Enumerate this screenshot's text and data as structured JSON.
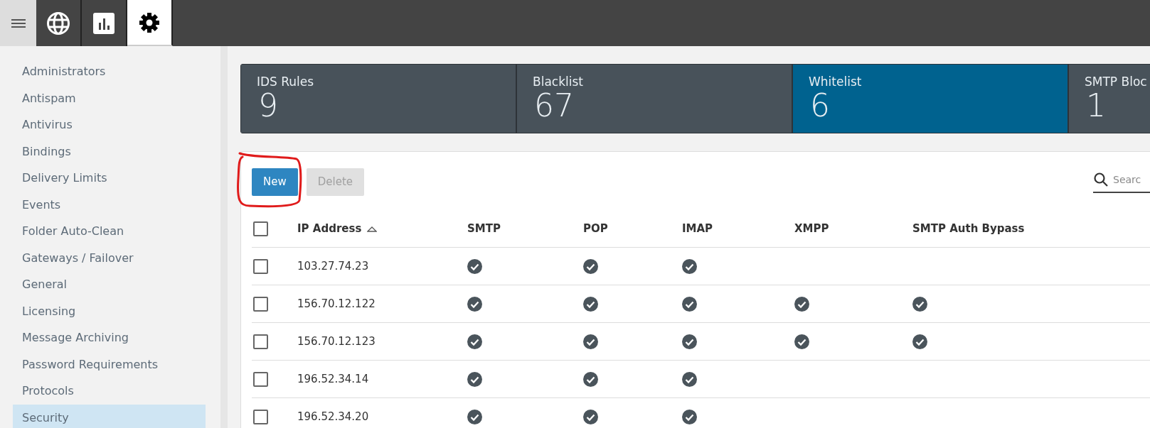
{
  "top_tabs": [
    {
      "kind": "menu",
      "selected": false
    },
    {
      "kind": "globe",
      "selected": false
    },
    {
      "kind": "chart",
      "selected": false
    },
    {
      "kind": "gear",
      "selected": true
    }
  ],
  "sidebar": {
    "items": [
      {
        "label": "Administrators",
        "selected": false
      },
      {
        "label": "Antispam",
        "selected": false
      },
      {
        "label": "Antivirus",
        "selected": false
      },
      {
        "label": "Bindings",
        "selected": false
      },
      {
        "label": "Delivery Limits",
        "selected": false
      },
      {
        "label": "Events",
        "selected": false
      },
      {
        "label": "Folder Auto-Clean",
        "selected": false
      },
      {
        "label": "Gateways / Failover",
        "selected": false
      },
      {
        "label": "General",
        "selected": false
      },
      {
        "label": "Licensing",
        "selected": false
      },
      {
        "label": "Message Archiving",
        "selected": false
      },
      {
        "label": "Password Requirements",
        "selected": false
      },
      {
        "label": "Protocols",
        "selected": false
      },
      {
        "label": "Security",
        "selected": true
      }
    ]
  },
  "summary_cards": [
    {
      "title": "IDS Rules",
      "count": "9",
      "selected": false
    },
    {
      "title": "Blacklist",
      "count": "67",
      "selected": false
    },
    {
      "title": "Whitelist",
      "count": "6",
      "selected": true
    },
    {
      "title": "SMTP Bloc",
      "count": "1",
      "selected": false
    }
  ],
  "toolbar": {
    "buttons": [
      {
        "label": "New",
        "disabled": false
      },
      {
        "label": "Delete",
        "disabled": true
      }
    ],
    "search": {
      "placeholder": "Searc"
    }
  },
  "table": {
    "select_all": {
      "checked": false
    },
    "columns": [
      {
        "label": "IP Address",
        "sorted": true
      },
      {
        "label": "SMTP",
        "sorted": false
      },
      {
        "label": "POP",
        "sorted": false
      },
      {
        "label": "IMAP",
        "sorted": false
      },
      {
        "label": "XMPP",
        "sorted": false
      },
      {
        "label": "SMTP Auth Bypass",
        "sorted": false
      }
    ],
    "rows": [
      {
        "checked": false,
        "ip": "103.27.74.23",
        "smtp": true,
        "pop": true,
        "imap": true,
        "xmpp": false,
        "smtp_auth_bypass": false
      },
      {
        "checked": false,
        "ip": "156.70.12.122",
        "smtp": true,
        "pop": true,
        "imap": true,
        "xmpp": true,
        "smtp_auth_bypass": true
      },
      {
        "checked": false,
        "ip": "156.70.12.123",
        "smtp": true,
        "pop": true,
        "imap": true,
        "xmpp": true,
        "smtp_auth_bypass": true
      },
      {
        "checked": false,
        "ip": "196.52.34.14",
        "smtp": true,
        "pop": true,
        "imap": true,
        "xmpp": false,
        "smtp_auth_bypass": false
      },
      {
        "checked": false,
        "ip": "196.52.34.20",
        "smtp": true,
        "pop": true,
        "imap": true,
        "xmpp": false,
        "smtp_auth_bypass": false
      }
    ]
  },
  "annotation": {
    "kind": "freehand-circle",
    "color": "#e01b1b"
  }
}
